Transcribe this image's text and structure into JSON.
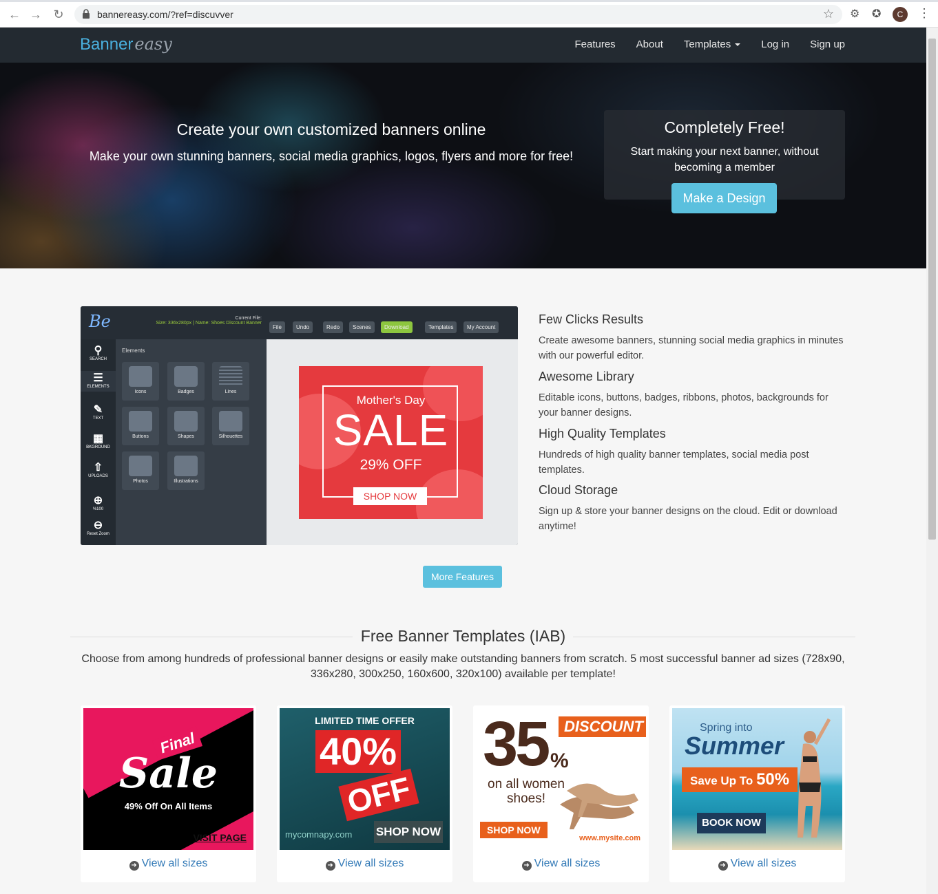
{
  "browser": {
    "url": "bannereasy.com/?ref=discuvver",
    "profile_initial": "C"
  },
  "navbar": {
    "logo_main": "Banner",
    "logo_script": "easy",
    "items": [
      "Features",
      "About",
      "Templates",
      "Log in",
      "Sign up"
    ]
  },
  "hero": {
    "title": "Create your own customized banners online",
    "subtitle": "Make your own stunning banners, social media graphics, logos, flyers and more for free!",
    "box_title": "Completely Free!",
    "box_text": "Start making your next banner, without becoming a member",
    "cta": "Make a Design"
  },
  "editor": {
    "logo": "Be",
    "current_file_label": "Current File:",
    "file_meta": "Size: 336x280px | Name: Shoes Discount Banner",
    "toolbar": [
      "File",
      "Undo",
      "Redo",
      "Scenes",
      "Download",
      "Templates",
      "My Account"
    ],
    "sidebar": [
      "SEARCH",
      "ELEMENTS",
      "TEXT",
      "BKGROUND",
      "UPLOADS",
      "%100",
      "Reset Zoom"
    ],
    "panel_title": "Elements",
    "tiles": [
      "Icons",
      "Badges",
      "Lines",
      "Buttons",
      "Shapes",
      "Silhouettes",
      "Photos",
      "Illustrations"
    ],
    "banner": {
      "title": "Mother's Day",
      "headline": "SALE",
      "offer": "29% OFF",
      "cta": "SHOP NOW"
    }
  },
  "features": [
    {
      "title": "Few Clicks Results",
      "text": "Create awesome banners, stunning social media graphics in minutes with our powerful editor."
    },
    {
      "title": "Awesome Library",
      "text": "Editable icons, buttons, badges, ribbons, photos, backgrounds for your banner designs."
    },
    {
      "title": "High Quality Templates",
      "text": "Hundreds of high quality banner templates, social media post templates."
    },
    {
      "title": "Cloud Storage",
      "text": "Sign up & store your banner designs on the cloud. Edit or download anytime!"
    }
  ],
  "more_features": "More Features",
  "templates_section": {
    "title": "Free Banner Templates (IAB)",
    "description": "Choose from among hundreds of professional banner designs or easily make outstanding banners from scratch. 5 most successful banner ad sizes (728x90, 336x280, 300x250, 160x600, 320x100) available per template!"
  },
  "cards": [
    {
      "link": "View all sizes",
      "final": "Final",
      "sale": "Sale",
      "sub": "49% Off On All Items",
      "cta": "VISIT PAGE"
    },
    {
      "link": "View all sizes",
      "top": "LIMITED TIME OFFER",
      "pct": "40%",
      "off": "OFF",
      "site": "mycomnapy.com",
      "cta": "SHOP NOW"
    },
    {
      "link": "View all sizes",
      "num": "35",
      "pct": "%",
      "discount": "DISCOUNT",
      "women": "on all women shoes!",
      "cta": "SHOP NOW",
      "site": "www.mysite.com"
    },
    {
      "link": "View all sizes",
      "spring": "Spring into",
      "summer": "Summer",
      "save": "Save Up To",
      "save_pct": "50%",
      "cta": "BOOK NOW"
    }
  ],
  "colors": {
    "navbar": "#232a31",
    "accent": "#5bc0de",
    "link": "#337ab7",
    "logo_blue": "#4ab0de"
  }
}
